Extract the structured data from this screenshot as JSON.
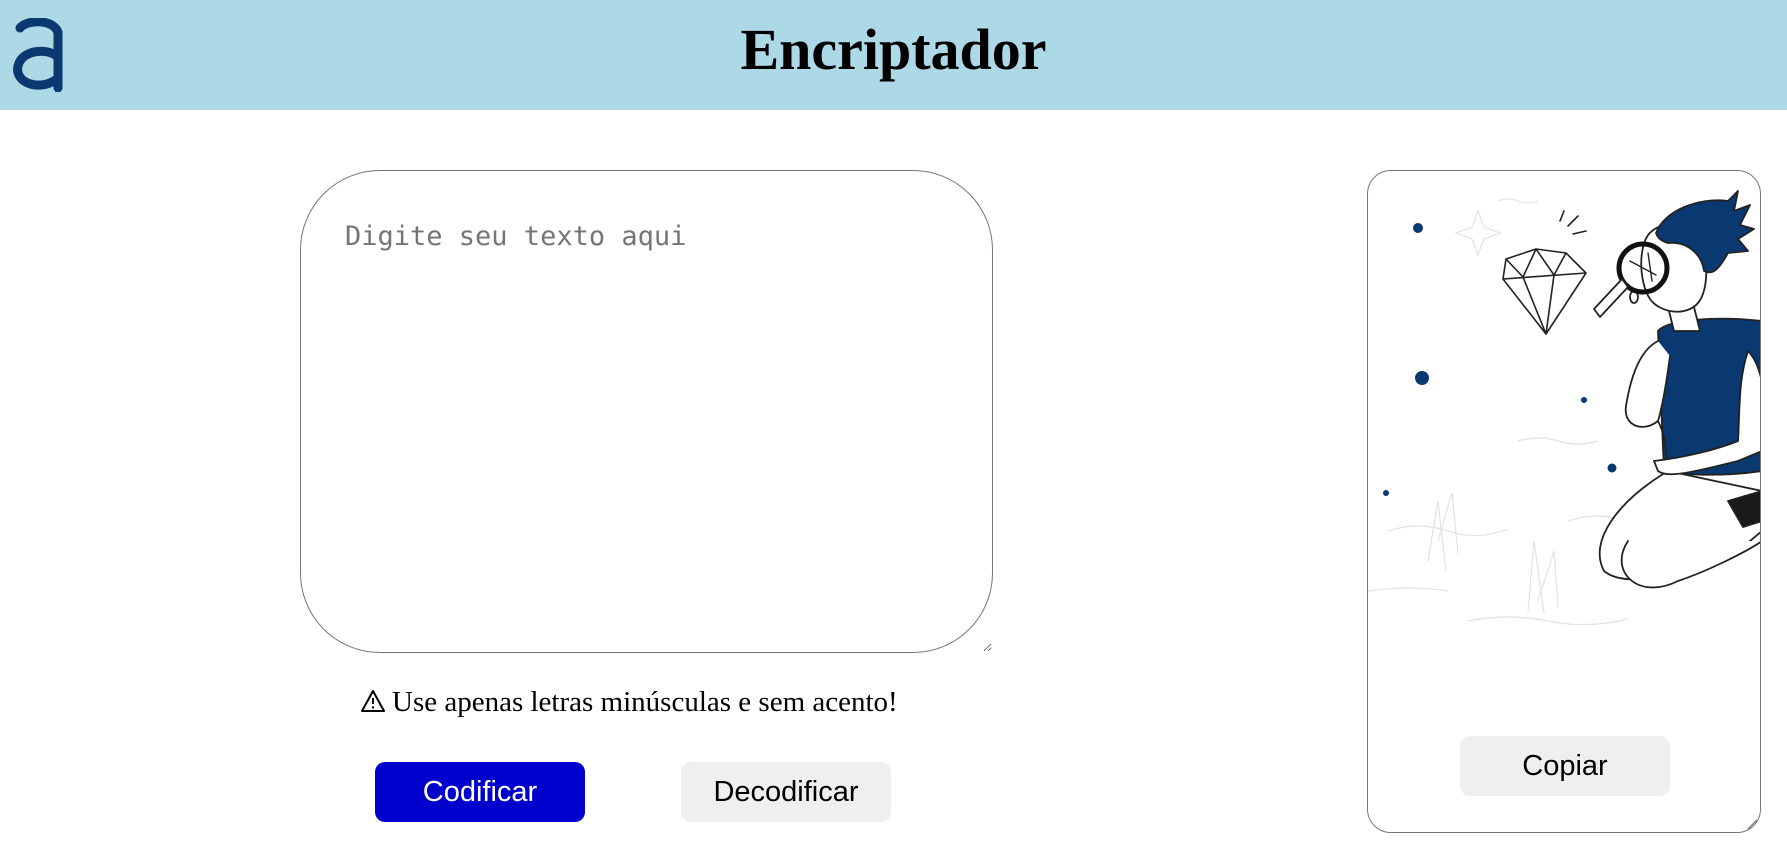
{
  "header": {
    "logo_icon": "alura-a-logo",
    "title": "Encriptador",
    "background_color": "#add8e6"
  },
  "input": {
    "placeholder": "Digite seu texto aqui",
    "value": ""
  },
  "warning": {
    "icon": "warning-triangle-icon",
    "text": "Use apenas letras minúsculas e sem acento!"
  },
  "buttons": {
    "encode_label": "Codificar",
    "decode_label": "Decodificar",
    "copy_label": "Copiar",
    "encode_color": "#0000cd",
    "secondary_color": "#efefef"
  },
  "output": {
    "illustration": "person-with-magnifying-glass-looking-at-diamond",
    "accent_color": "#0a3871"
  }
}
